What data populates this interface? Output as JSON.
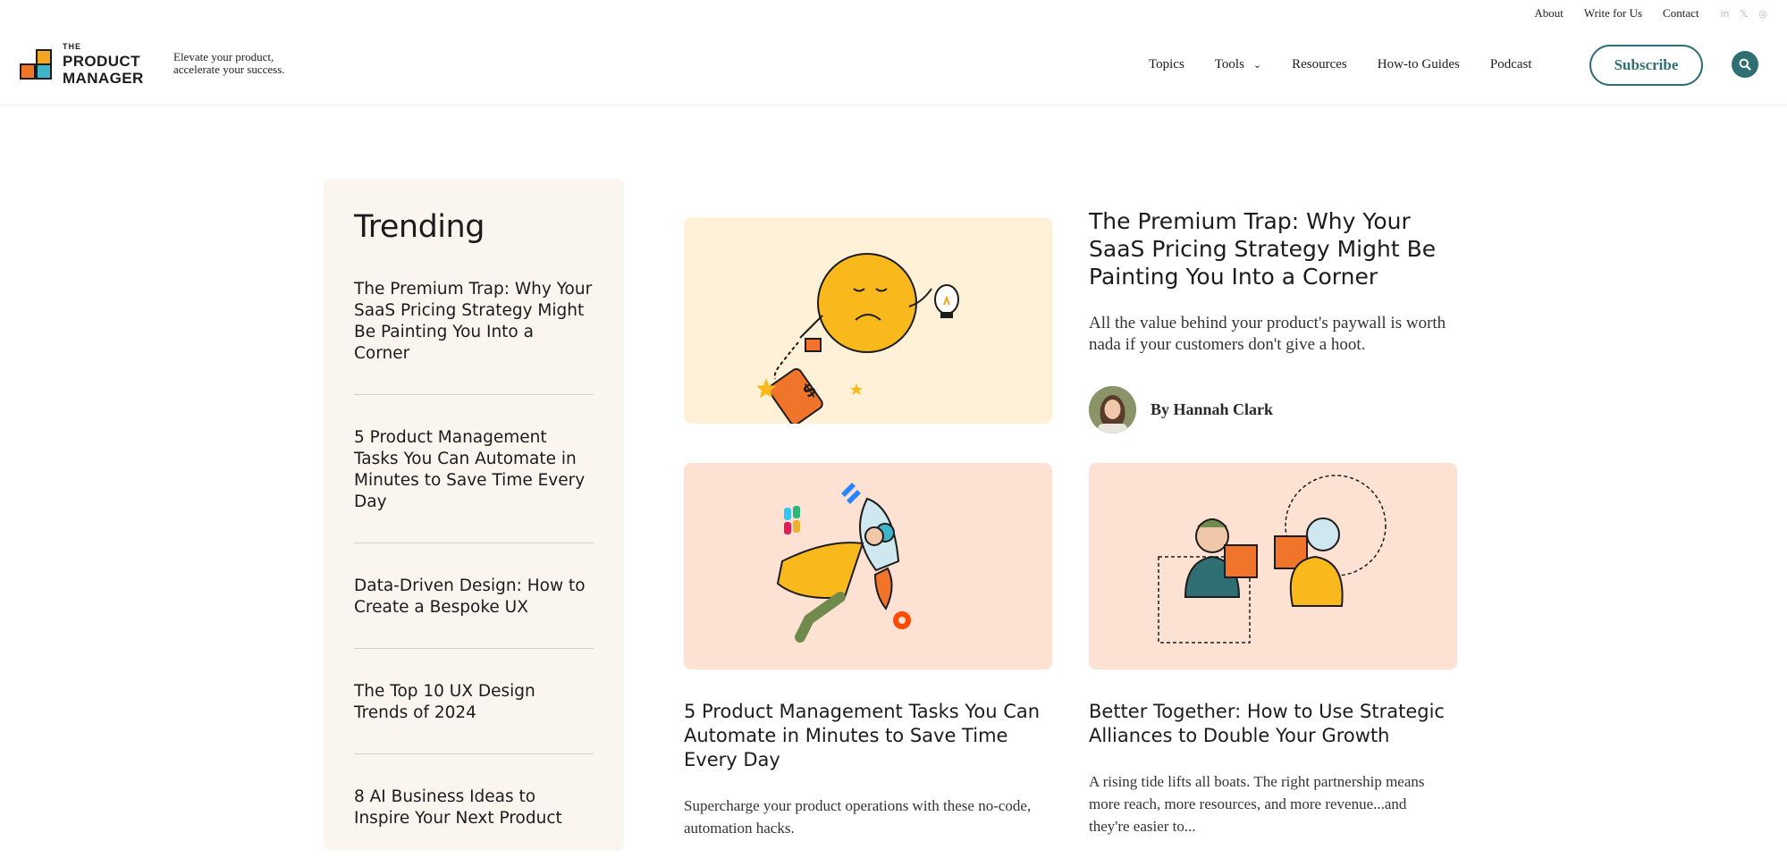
{
  "utility": {
    "links": [
      "About",
      "Write for Us",
      "Contact"
    ],
    "social_icons": [
      "in",
      "𝕏",
      "◎"
    ]
  },
  "brand": {
    "logo_the": "THE",
    "logo_line1": "PRODUCT",
    "logo_line2": "MANAGER",
    "tagline_line1": "Elevate your product,",
    "tagline_line2": "accelerate your success."
  },
  "nav": {
    "items": [
      "Topics",
      "Tools",
      "Resources",
      "How-to Guides",
      "Podcast"
    ],
    "subscribe": "Subscribe"
  },
  "trending": {
    "heading": "Trending",
    "items": [
      "The Premium Trap: Why Your SaaS Pricing Strategy Might Be Painting You Into a Corner",
      "5 Product Management Tasks You Can Automate in Minutes to Save Time Every Day",
      "Data-Driven Design: How to Create a Bespoke UX",
      "The Top 10 UX Design Trends of 2024",
      "8 AI Business Ideas to Inspire Your Next Product"
    ]
  },
  "featured": {
    "title": "The Premium Trap: Why Your SaaS Pricing Strategy Might Be Painting You Into a Corner",
    "description": "All the value behind your product's paywall is worth nada if your customers don't give a hoot.",
    "author": "By Hannah Clark"
  },
  "cards": [
    {
      "title": "5 Product Management Tasks You Can Automate in Minutes to Save Time Every Day",
      "description": "Supercharge your product operations with these no-code, automation hacks."
    },
    {
      "title": "Better Together: How to Use Strategic Alliances to Double Your Growth",
      "description": "A rising tide lifts all boats. The right partnership means more reach, more resources, and more revenue...and they're easier to..."
    }
  ],
  "colors": {
    "accent": "#2f6f73",
    "sidebar_bg": "#faf5ef",
    "img_yellow_bg": "#fff0d8",
    "img_peach_bg": "#fde1d3"
  }
}
